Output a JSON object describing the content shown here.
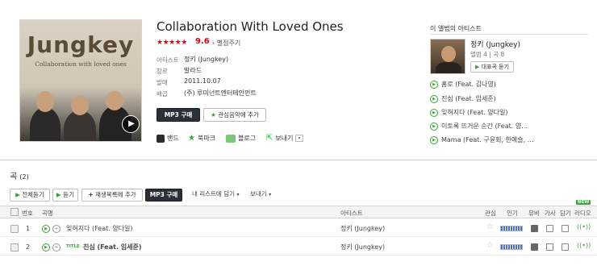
{
  "album": {
    "cover_title": "Jungkey",
    "cover_subtitle": "Collaboration with loved ones",
    "title": "Collaboration With Loved Ones",
    "stars": "★★★★★",
    "score": "9.6",
    "rate_label": "별점주기",
    "meta": [
      {
        "key": "아티스트",
        "value": "정키 (Jungkey)"
      },
      {
        "key": "장르",
        "value": "발라드"
      },
      {
        "key": "발매",
        "value": "2011.10.07"
      },
      {
        "key": "배급",
        "value": "(주) 루미넌트엔터테인먼트"
      }
    ],
    "mp3_label": "MP3 구매",
    "fav_label": "관심음악에 추가",
    "actions": {
      "band": "밴드",
      "bookmark": "북마크",
      "blog": "블로그",
      "send": "보내기"
    }
  },
  "artist_panel": {
    "title": "이 앨범의 아티스트",
    "name": "정키 (Jungkey)",
    "stats": "앨범 4  |  곡 8",
    "rep_song_label": "대표곡 듣기",
    "songs": [
      "홈로 (Feat. 김나영)",
      "진심 (Feat. 임세준)",
      "잊혀지다 (Feat. 양다일)",
      "이토록 뜨거운 순간 (Feat. 양…",
      "Mama (Feat. 구윤회, 한예슬, …"
    ]
  },
  "track_list": {
    "title": "곡",
    "count": "(2)",
    "toolbar": {
      "play_all": "전체듣기",
      "listen": "듣기",
      "add_playlist": "재생목록에 추가",
      "mp3": "MP3 구매",
      "add_my_list": "내 리스트에 담기",
      "send": "보내기"
    },
    "columns": {
      "no": "번호",
      "song": "곡명",
      "artist": "아티스트",
      "fav": "관심",
      "popularity": "인기",
      "video": "뮤비",
      "lyrics": "가사",
      "add": "담기",
      "radio": "라디오"
    },
    "new_badge": "NEW",
    "rows": [
      {
        "no": "1",
        "title_badge": "",
        "song": "잊혀지다 (Feat. 양다일)",
        "artist": "정키 (Jungkey)"
      },
      {
        "no": "2",
        "title_badge": "TITLE",
        "song": "진심 (Feat. 임세준)",
        "artist": "정키 (Jungkey)"
      }
    ]
  }
}
